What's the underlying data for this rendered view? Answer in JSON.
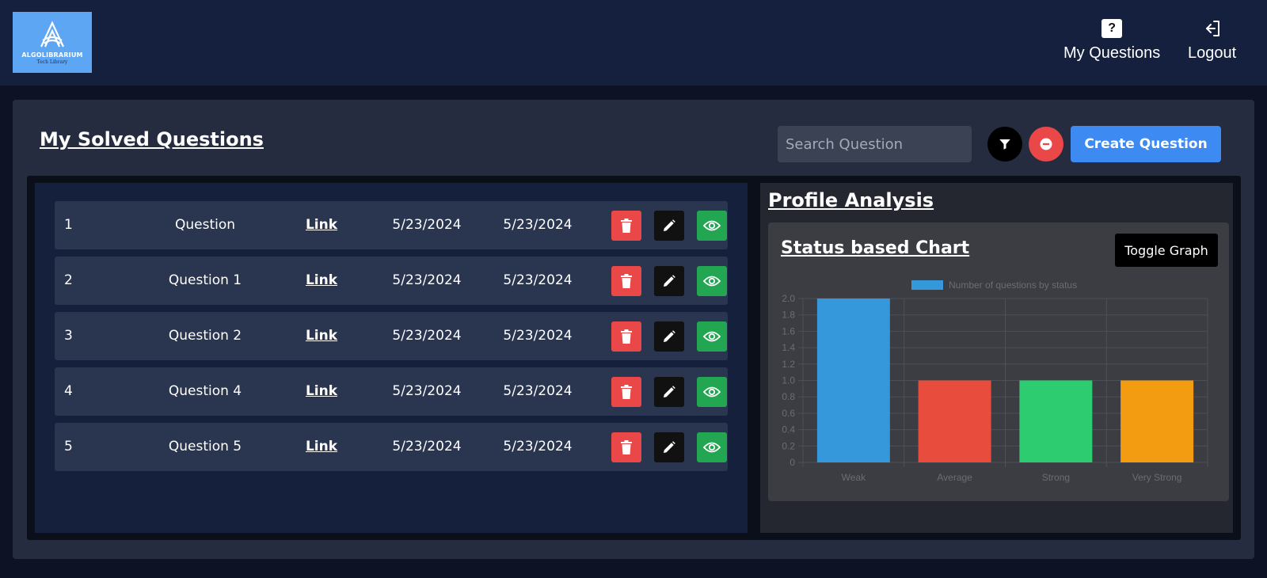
{
  "header": {
    "logo": {
      "title": "ALGOLIBRARIUM",
      "subtitle": "Tech Library"
    },
    "nav": [
      {
        "label": "My Questions",
        "icon": "question-mark-icon"
      },
      {
        "label": "Logout",
        "icon": "logout-icon"
      }
    ]
  },
  "main": {
    "title": "My Solved Questions",
    "search": {
      "placeholder": "Search Question",
      "value": ""
    },
    "filter_icon": "filter-icon",
    "clear_icon": "minus-circle-icon",
    "create_label": "Create Question"
  },
  "questions": [
    {
      "num": "1",
      "name": "Question",
      "link": "Link",
      "date1": "5/23/2024",
      "date2": "5/23/2024"
    },
    {
      "num": "2",
      "name": "Question 1",
      "link": "Link",
      "date1": "5/23/2024",
      "date2": "5/23/2024"
    },
    {
      "num": "3",
      "name": "Question 2",
      "link": "Link",
      "date1": "5/23/2024",
      "date2": "5/23/2024"
    },
    {
      "num": "4",
      "name": "Question 4",
      "link": "Link",
      "date1": "5/23/2024",
      "date2": "5/23/2024"
    },
    {
      "num": "5",
      "name": "Question 5",
      "link": "Link",
      "date1": "5/23/2024",
      "date2": "5/23/2024"
    }
  ],
  "colors": {
    "delete": "#ea4848",
    "edit": "#111111",
    "view": "#22a651",
    "accent": "#3d8bf2"
  },
  "analysis": {
    "title": "Profile Analysis",
    "chart_title": "Status based Chart",
    "toggle_label": "Toggle Graph"
  },
  "chart_data": {
    "type": "bar",
    "categories": [
      "Weak",
      "Average",
      "Strong",
      "Very Strong"
    ],
    "series": [
      {
        "name": "Number of questions by status",
        "values": [
          2,
          1,
          1,
          1
        ]
      }
    ],
    "colors": [
      "#3498db",
      "#e74c3c",
      "#2ecc71",
      "#f39c12"
    ],
    "ylim": [
      0,
      2.0
    ],
    "yticks": [
      "0",
      "0.2",
      "0.4",
      "0.6",
      "0.8",
      "1.0",
      "1.2",
      "1.4",
      "1.6",
      "1.8",
      "2.0"
    ],
    "grid": true,
    "legend": "top-center"
  }
}
